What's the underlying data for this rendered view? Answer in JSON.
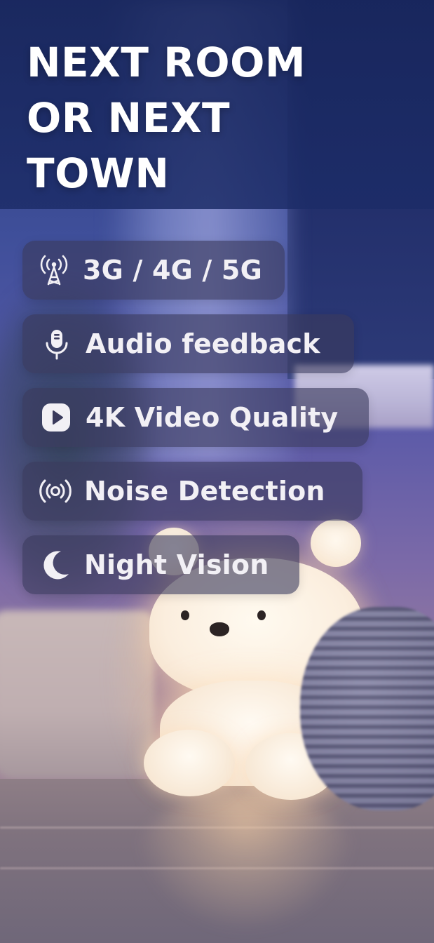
{
  "headline": {
    "line1": "NEXT ROOM",
    "line2": "OR NEXT",
    "line3": "TOWN"
  },
  "features": [
    {
      "label": "3G / 4G / 5G",
      "icon": "cell-tower-icon"
    },
    {
      "label": "Audio feedback",
      "icon": "microphone-icon"
    },
    {
      "label": "4K Video Quality",
      "icon": "play-icon"
    },
    {
      "label": "Noise Detection",
      "icon": "sound-waves-icon"
    },
    {
      "label": "Night Vision",
      "icon": "moon-icon"
    }
  ],
  "colors": {
    "header_background": "#1c2c68",
    "pill_background": "#3a3a5c",
    "text": "#ffffff"
  }
}
